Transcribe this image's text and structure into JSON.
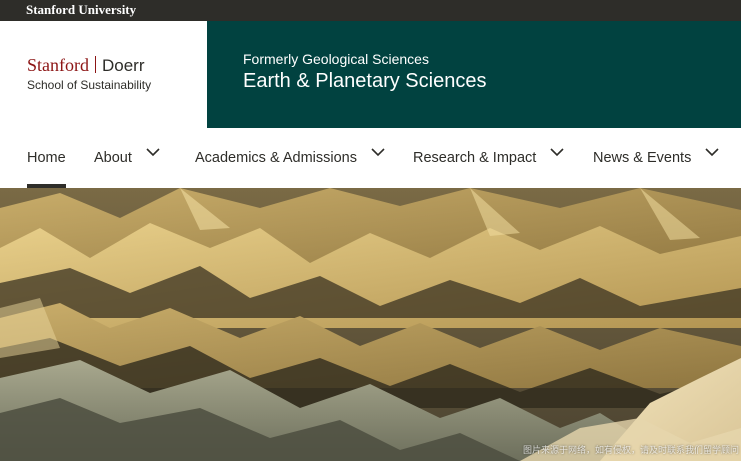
{
  "topbar": {
    "university": "Stanford University"
  },
  "brand": {
    "stanford": "Stanford",
    "doerr": "Doerr",
    "school": "School of Sustainability"
  },
  "department": {
    "formerly": "Formerly Geological Sciences",
    "name": "Earth & Planetary Sciences"
  },
  "nav": {
    "items": [
      {
        "label": "Home",
        "active": true,
        "has_dropdown": false
      },
      {
        "label": "About",
        "active": false,
        "has_dropdown": true
      },
      {
        "label": "Academics & Admissions",
        "active": false,
        "has_dropdown": true
      },
      {
        "label": "Research & Impact",
        "active": false,
        "has_dropdown": true
      },
      {
        "label": "News & Events",
        "active": false,
        "has_dropdown": true
      }
    ]
  },
  "hero": {
    "image": "badlands-landscape-photo",
    "watermark": "图片来源于网络，如有侵权，请及时联系我们留学顾问"
  },
  "colors": {
    "topbar": "#2e2d29",
    "cardinal": "#8c1515",
    "department_panel": "#014240",
    "text": "#2e2d29"
  }
}
